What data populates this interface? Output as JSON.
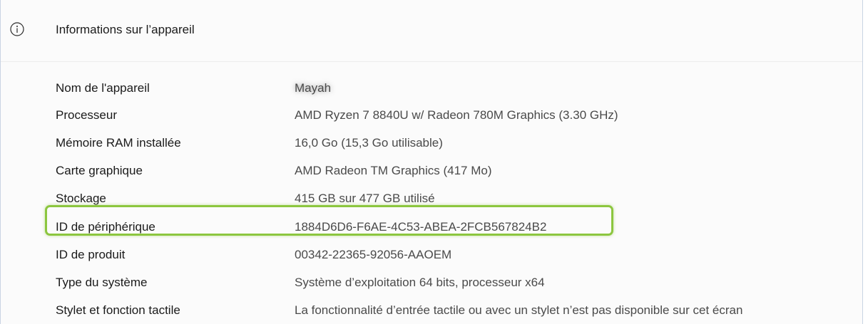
{
  "header": {
    "icon": "info-icon",
    "title": "Informations sur l’appareil"
  },
  "rows": [
    {
      "label": "Nom de l'appareil",
      "value": "Mayah"
    },
    {
      "label": "Processeur",
      "value": "AMD Ryzen 7 8840U w/ Radeon 780M Graphics (3.30 GHz)"
    },
    {
      "label": "Mémoire RAM installée",
      "value": "16,0 Go (15,3 Go utilisable)"
    },
    {
      "label": "Carte graphique",
      "value": "AMD Radeon TM Graphics (417 Mo)"
    },
    {
      "label": "Stockage",
      "value": "415 GB sur 477 GB utilisé"
    },
    {
      "label": "ID de périphérique",
      "value": "1884D6D6-F6AE-4C53-ABEA-2FCB567824B2"
    },
    {
      "label": "ID de produit",
      "value": "00342-22365-92056-AAOEM"
    },
    {
      "label": "Type du système",
      "value": "Système d’exploitation 64 bits, processeur x64"
    },
    {
      "label": "Stylet et fonction tactile",
      "value": "La fonctionnalité d’entrée tactile ou avec un stylet n’est pas disponible sur cet écran"
    }
  ],
  "colors": {
    "highlight": "#8cc63f",
    "panel_border": "#c9d4e3"
  }
}
